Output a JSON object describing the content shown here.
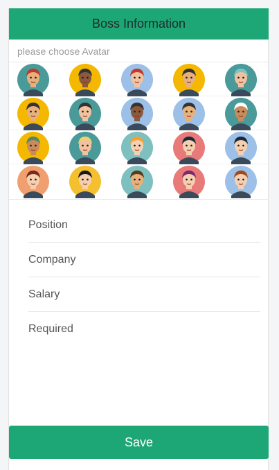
{
  "header": {
    "title": "Boss Information"
  },
  "avatar_picker": {
    "placeholder": "please choose Avatar",
    "avatars": [
      {
        "bg": "#4a9a9a",
        "skin": "#e8b07a",
        "hair": "#c0392b",
        "icon": "avatar-man-red-cap-icon"
      },
      {
        "bg": "#f5b800",
        "skin": "#8b5a3c",
        "hair": "#333333",
        "icon": "avatar-man-glasses-icon"
      },
      {
        "bg": "#9dc0e8",
        "skin": "#f2c2a0",
        "hair": "#c0392b",
        "icon": "avatar-woman-red-hair-icon"
      },
      {
        "bg": "#f5b800",
        "skin": "#e8b07a",
        "hair": "#333333",
        "icon": "avatar-man-beard-icon"
      },
      {
        "bg": "#4a9a9a",
        "skin": "#f2c2a0",
        "hair": "#7ec4c4",
        "icon": "avatar-woman-teal-hair-icon"
      },
      {
        "bg": "#f5b800",
        "skin": "#e8b07a",
        "hair": "#333333",
        "icon": "avatar-man-beard-glasses-icon"
      },
      {
        "bg": "#4a9a9a",
        "skin": "#f2c2a0",
        "hair": "#333333",
        "icon": "avatar-woman-glasses-icon"
      },
      {
        "bg": "#9dc0e8",
        "skin": "#8b5a3c",
        "hair": "#333333",
        "icon": "avatar-woman-dark-skin-icon"
      },
      {
        "bg": "#9dc0e8",
        "skin": "#e8b07a",
        "hair": "#333333",
        "icon": "avatar-man-dark-beard-icon"
      },
      {
        "bg": "#4a9a9a",
        "skin": "#c98b5a",
        "hair": "#ffffff",
        "icon": "avatar-man-white-hat-icon"
      },
      {
        "bg": "#f5b800",
        "skin": "#c98b5a",
        "hair": "#4a8a6a",
        "icon": "avatar-man-green-cap-icon"
      },
      {
        "bg": "#4a9a9a",
        "skin": "#f2c2a0",
        "hair": "#f0d070",
        "icon": "avatar-woman-blonde-icon"
      },
      {
        "bg": "#ffffff",
        "skin": "#f5d0b0",
        "hair": "#f5a030",
        "icon": "avatar-girl-orange-hair-icon"
      },
      {
        "bg": "#ffffff",
        "skin": "#f5d0b0",
        "hair": "#1a2a3a",
        "icon": "avatar-girl-mask-icon"
      },
      {
        "bg": "#ffffff",
        "skin": "#f5d0b0",
        "hair": "#1a2a3a",
        "icon": "avatar-boy-blue-glasses-icon"
      },
      {
        "bg": "#ffffff",
        "skin": "#f5d0b0",
        "hair": "#7a2a1a",
        "icon": "avatar-woman-brown-hair-icon"
      },
      {
        "bg": "#ffffff",
        "skin": "#f5d0b0",
        "hair": "#1a1a1a",
        "icon": "avatar-boy-peace-sign-icon"
      },
      {
        "bg": "#ffffff",
        "skin": "#e8b07a",
        "hair": "#5a3a1a",
        "icon": "avatar-man-mustache-icon"
      },
      {
        "bg": "#ffffff",
        "skin": "#f5d0b0",
        "hair": "#7a2a6a",
        "icon": "avatar-woman-crown-icon"
      },
      {
        "bg": "#ffffff",
        "skin": "#f5d0b0",
        "hair": "#a04a1a",
        "icon": "avatar-old-man-icon"
      }
    ]
  },
  "form": {
    "position": "Position",
    "company": "Company",
    "salary": "Salary",
    "required": "Required"
  },
  "actions": {
    "save_label": "Save"
  },
  "colors": {
    "accent": "#1ea776",
    "header_text": "#1b2b2b"
  }
}
